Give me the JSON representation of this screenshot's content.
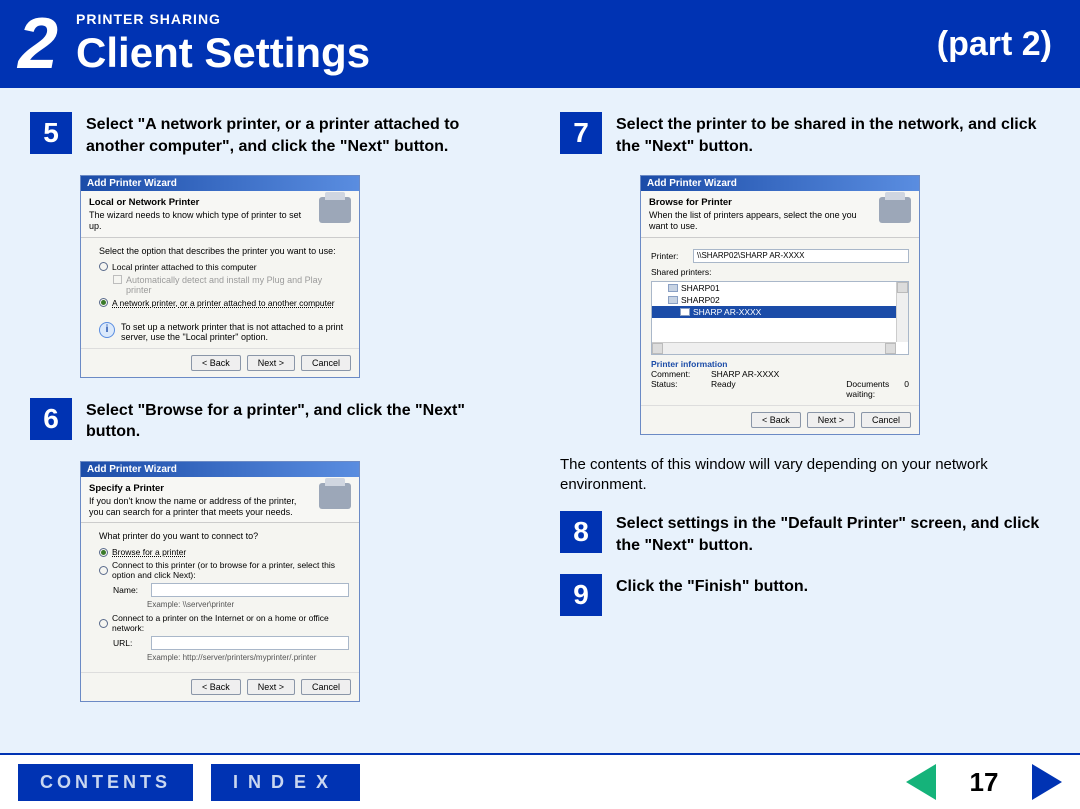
{
  "header": {
    "chapter_number": "2",
    "section": "PRINTER SHARING",
    "title": "Client Settings",
    "part": "(part 2)"
  },
  "left_col": {
    "step5": {
      "num": "5",
      "text": "Select \"A network printer, or a printer attached to another computer\", and click the \"Next\" button."
    },
    "step6": {
      "num": "6",
      "text": "Select \"Browse for a printer\", and click the \"Next\" button."
    }
  },
  "right_col": {
    "step7": {
      "num": "7",
      "text": "Select the printer to be shared in the network, and click the \"Next\" button."
    },
    "note7": "The contents of this window will vary depending on your network environment.",
    "step8": {
      "num": "8",
      "text": "Select settings in the \"Default Printer\" screen, and click the \"Next\" button."
    },
    "step9": {
      "num": "9",
      "text": "Click the \"Finish\" button."
    }
  },
  "wizard_common": {
    "title": "Add Printer Wizard",
    "back": "< Back",
    "next": "Next >",
    "cancel": "Cancel"
  },
  "wizard5": {
    "heading": "Local or Network Printer",
    "sub": "The wizard needs to know which type of printer to set up.",
    "intro": "Select the option that describes the printer you want to use:",
    "opt1": "Local printer attached to this computer",
    "opt1_chk": "Automatically detect and install my Plug and Play printer",
    "opt2": "A network printer, or a printer attached to another computer",
    "info": "To set up a network printer that is not attached to a print server, use the \"Local printer\" option."
  },
  "wizard6": {
    "heading": "Specify a Printer",
    "sub": "If you don't know the name or address of the printer, you can search for a printer that meets your needs.",
    "intro": "What printer do you want to connect to?",
    "opt1": "Browse for a printer",
    "opt2": "Connect to this printer (or to browse for a printer, select this option and click Next):",
    "name_lbl": "Name:",
    "name_ex": "Example: \\\\server\\printer",
    "opt3": "Connect to a printer on the Internet or on a home or office network:",
    "url_lbl": "URL:",
    "url_ex": "Example: http://server/printers/myprinter/.printer"
  },
  "wizard7": {
    "heading": "Browse for Printer",
    "sub": "When the list of printers appears, select the one you want to use.",
    "printer_lbl": "Printer:",
    "printer_val": "\\\\SHARP02\\SHARP AR-XXXX",
    "shared_lbl": "Shared printers:",
    "tree": {
      "n1": "SHARP01",
      "n2": "SHARP02",
      "n3": "SHARP AR-XXXX"
    },
    "pinfo_hdr": "Printer information",
    "comment_lbl": "Comment:",
    "comment_val": "SHARP AR-XXXX",
    "status_lbl": "Status:",
    "status_val": "Ready",
    "docs_lbl": "Documents waiting:",
    "docs_val": "0"
  },
  "footer": {
    "contents": "CONTENTS",
    "index": "INDEX",
    "page": "17"
  }
}
